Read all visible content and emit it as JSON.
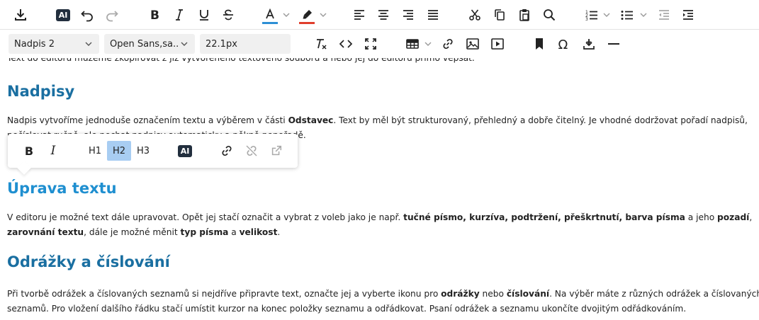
{
  "toolbar": {
    "block_format": "Nadpis 2",
    "font_family": "Open Sans,sa...",
    "font_size": "22.1px",
    "ai_label": "AI",
    "text_color": "#2d8fd5",
    "highlight_color": "#e03e2d"
  },
  "quickbar": {
    "bold": "B",
    "italic": "I",
    "h1": "H1",
    "h2": "H2",
    "h3": "H3",
    "ai": "AI",
    "active_item": "H2"
  },
  "content": {
    "top_partial": "Text do editoru můžeme zkopírovat z již vytvořeného textového souboru a nebo jej do editoru přímo vepsat.",
    "h_nadpisy": "Nadpisy",
    "p_nadpisy_a": "Nadpis vytvoříme jednoduše označením textu a výběrem v části ",
    "p_nadpisy_b": "Odstavec",
    "p_nadpisy_c": ". Text by měl být strukturovaný, přehledný a dobře čitelný. Je vhodné dodržovat pořadí nadpisů,",
    "p_nadpisy_line2": "nečíslovat ručně, ale nechat nadpisy automaticky a pěkně popořadě.",
    "h_uprava": "Úprava textu",
    "p_uprava_1": "V editoru je možné text dále upravovat. Opět jej stačí označit a vybrat z voleb jako je např. ",
    "p_uprava_2": "tučné písmo, kurzíva, podtržení, přeškrtnutí, barva písma",
    "p_uprava_3": " a jeho ",
    "p_uprava_4": "pozadí",
    "p_uprava_5": ",",
    "p_uprava_6": "zarovnání textu",
    "p_uprava_7": ", dále je možné měnit ",
    "p_uprava_8": "typ písma",
    "p_uprava_9": " a ",
    "p_uprava_10": "velikost",
    "p_uprava_11": ".",
    "h_odrazky": "Odrážky a číslování",
    "p_odrazky_1": "Při tvorbě odrážek a číslovaných seznamů si nejdříve připravte text, označte jej a vyberte ikonu pro ",
    "p_odrazky_2": "odrážky",
    "p_odrazky_3": " nebo ",
    "p_odrazky_4": "číslování",
    "p_odrazky_5": ". Na výběr máte z různých odrážek a číslovaných",
    "p_odrazky_line2": "seznamů. Pro vložení dalšího řádku stačí umístit kurzor na konec položky seznamu a odřádkovat. Psaní odrážek a seznamu ukončíte dvojitým odřádkováním."
  }
}
